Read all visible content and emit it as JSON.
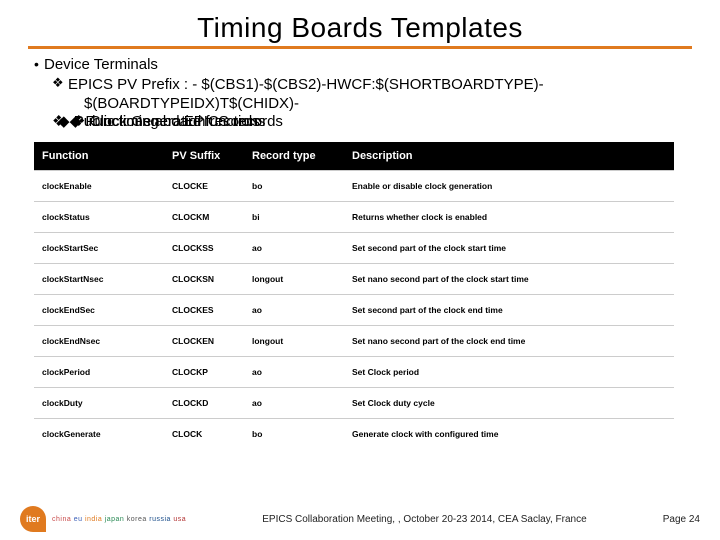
{
  "title": "Timing Boards Templates",
  "bullets": {
    "l1": "Device Terminals",
    "l2a": "EPICS PV Prefix : - $(CBS1)-$(CBS2)-HWCF:$(SHORTBOARDTYPE)-",
    "l2b": "$(BOARDTYPEIDX)T$(CHIDX)-",
    "ov1": "Functions and EPICS records",
    "ov2": "Public timing board functions",
    "ov3": "Clock Generation records"
  },
  "table": {
    "headers": [
      "Function",
      "PV Suffix",
      "Record type",
      "Description"
    ],
    "rows": [
      [
        "clockEnable",
        "CLOCKE",
        "bo",
        "Enable or disable clock generation"
      ],
      [
        "clockStatus",
        "CLOCKM",
        "bi",
        "Returns whether clock is enabled"
      ],
      [
        "clockStartSec",
        "CLOCKSS",
        "ao",
        "Set second part of the clock start time"
      ],
      [
        "clockStartNsec",
        "CLOCKSN",
        "longout",
        "Set nano second part of the clock start time"
      ],
      [
        "clockEndSec",
        "CLOCKES",
        "ao",
        "Set second part of the clock end time"
      ],
      [
        "clockEndNsec",
        "CLOCKEN",
        "longout",
        "Set nano second part of the clock end time"
      ],
      [
        "clockPeriod",
        "CLOCKP",
        "ao",
        "Set Clock period"
      ],
      [
        "clockDuty",
        "CLOCKD",
        "ao",
        "Set Clock duty cycle"
      ],
      [
        "clockGenerate",
        "CLOCK",
        "bo",
        "Generate clock with configured time"
      ]
    ]
  },
  "footer": {
    "logo": "iter",
    "countries": {
      "china": "china",
      "eu": "eu",
      "india": "india",
      "japan": "japan",
      "korea": "korea",
      "russia": "russia",
      "usa": "usa"
    },
    "center": "EPICS Collaboration Meeting, , October 20-23 2014, CEA Saclay, France",
    "page": "Page 24"
  },
  "glyphs": {
    "bullet": "•",
    "diamond": "❖",
    "fdiamond": "◆"
  }
}
